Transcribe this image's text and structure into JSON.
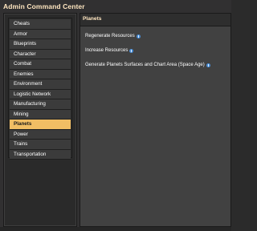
{
  "window": {
    "title": "Admin Command Center"
  },
  "sidebar": {
    "items": [
      {
        "label": "Cheats",
        "selected": false
      },
      {
        "label": "Armor",
        "selected": false
      },
      {
        "label": "Blueprints",
        "selected": false
      },
      {
        "label": "Character",
        "selected": false
      },
      {
        "label": "Combat",
        "selected": false
      },
      {
        "label": "Enemies",
        "selected": false
      },
      {
        "label": "Environment",
        "selected": false
      },
      {
        "label": "Logistic Network",
        "selected": false
      },
      {
        "label": "Manufacturing",
        "selected": false
      },
      {
        "label": "Mining",
        "selected": false
      },
      {
        "label": "Planets",
        "selected": true
      },
      {
        "label": "Power",
        "selected": false
      },
      {
        "label": "Trains",
        "selected": false
      },
      {
        "label": "Transportation",
        "selected": false
      }
    ]
  },
  "panel": {
    "header": "Planets",
    "options": [
      {
        "label": "Regenerate Resources",
        "icon": "info-icon"
      },
      {
        "label": "Increase Resources",
        "icon": "info-icon"
      },
      {
        "label": "Generate Planets Surfaces and Chart Area (Space Age)",
        "icon": "info-icon"
      }
    ]
  },
  "colors": {
    "accent": "#f1be64",
    "title": "#ffe6c0",
    "info": "#4b8fd8"
  }
}
